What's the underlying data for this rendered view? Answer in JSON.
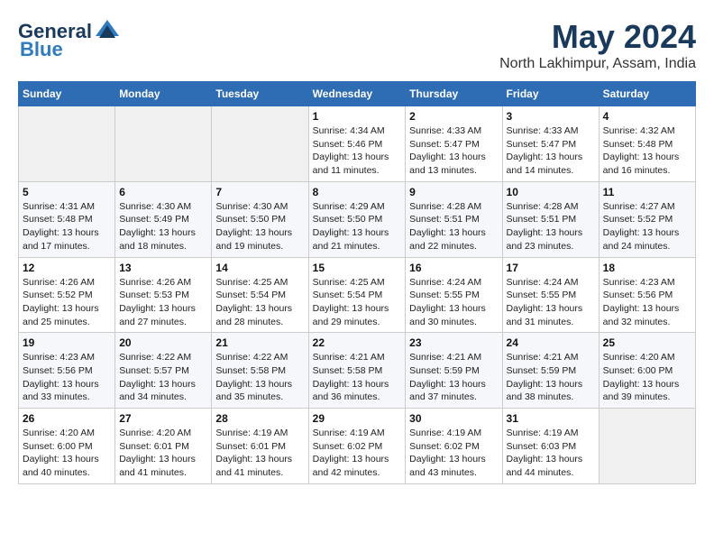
{
  "logo": {
    "general": "General",
    "blue": "Blue"
  },
  "title": "May 2024",
  "location": "North Lakhimpur, Assam, India",
  "weekdays": [
    "Sunday",
    "Monday",
    "Tuesday",
    "Wednesday",
    "Thursday",
    "Friday",
    "Saturday"
  ],
  "weeks": [
    [
      {
        "day": "",
        "info": ""
      },
      {
        "day": "",
        "info": ""
      },
      {
        "day": "",
        "info": ""
      },
      {
        "day": "1",
        "info": "Sunrise: 4:34 AM\nSunset: 5:46 PM\nDaylight: 13 hours\nand 11 minutes."
      },
      {
        "day": "2",
        "info": "Sunrise: 4:33 AM\nSunset: 5:47 PM\nDaylight: 13 hours\nand 13 minutes."
      },
      {
        "day": "3",
        "info": "Sunrise: 4:33 AM\nSunset: 5:47 PM\nDaylight: 13 hours\nand 14 minutes."
      },
      {
        "day": "4",
        "info": "Sunrise: 4:32 AM\nSunset: 5:48 PM\nDaylight: 13 hours\nand 16 minutes."
      }
    ],
    [
      {
        "day": "5",
        "info": "Sunrise: 4:31 AM\nSunset: 5:48 PM\nDaylight: 13 hours\nand 17 minutes."
      },
      {
        "day": "6",
        "info": "Sunrise: 4:30 AM\nSunset: 5:49 PM\nDaylight: 13 hours\nand 18 minutes."
      },
      {
        "day": "7",
        "info": "Sunrise: 4:30 AM\nSunset: 5:50 PM\nDaylight: 13 hours\nand 19 minutes."
      },
      {
        "day": "8",
        "info": "Sunrise: 4:29 AM\nSunset: 5:50 PM\nDaylight: 13 hours\nand 21 minutes."
      },
      {
        "day": "9",
        "info": "Sunrise: 4:28 AM\nSunset: 5:51 PM\nDaylight: 13 hours\nand 22 minutes."
      },
      {
        "day": "10",
        "info": "Sunrise: 4:28 AM\nSunset: 5:51 PM\nDaylight: 13 hours\nand 23 minutes."
      },
      {
        "day": "11",
        "info": "Sunrise: 4:27 AM\nSunset: 5:52 PM\nDaylight: 13 hours\nand 24 minutes."
      }
    ],
    [
      {
        "day": "12",
        "info": "Sunrise: 4:26 AM\nSunset: 5:52 PM\nDaylight: 13 hours\nand 25 minutes."
      },
      {
        "day": "13",
        "info": "Sunrise: 4:26 AM\nSunset: 5:53 PM\nDaylight: 13 hours\nand 27 minutes."
      },
      {
        "day": "14",
        "info": "Sunrise: 4:25 AM\nSunset: 5:54 PM\nDaylight: 13 hours\nand 28 minutes."
      },
      {
        "day": "15",
        "info": "Sunrise: 4:25 AM\nSunset: 5:54 PM\nDaylight: 13 hours\nand 29 minutes."
      },
      {
        "day": "16",
        "info": "Sunrise: 4:24 AM\nSunset: 5:55 PM\nDaylight: 13 hours\nand 30 minutes."
      },
      {
        "day": "17",
        "info": "Sunrise: 4:24 AM\nSunset: 5:55 PM\nDaylight: 13 hours\nand 31 minutes."
      },
      {
        "day": "18",
        "info": "Sunrise: 4:23 AM\nSunset: 5:56 PM\nDaylight: 13 hours\nand 32 minutes."
      }
    ],
    [
      {
        "day": "19",
        "info": "Sunrise: 4:23 AM\nSunset: 5:56 PM\nDaylight: 13 hours\nand 33 minutes."
      },
      {
        "day": "20",
        "info": "Sunrise: 4:22 AM\nSunset: 5:57 PM\nDaylight: 13 hours\nand 34 minutes."
      },
      {
        "day": "21",
        "info": "Sunrise: 4:22 AM\nSunset: 5:58 PM\nDaylight: 13 hours\nand 35 minutes."
      },
      {
        "day": "22",
        "info": "Sunrise: 4:21 AM\nSunset: 5:58 PM\nDaylight: 13 hours\nand 36 minutes."
      },
      {
        "day": "23",
        "info": "Sunrise: 4:21 AM\nSunset: 5:59 PM\nDaylight: 13 hours\nand 37 minutes."
      },
      {
        "day": "24",
        "info": "Sunrise: 4:21 AM\nSunset: 5:59 PM\nDaylight: 13 hours\nand 38 minutes."
      },
      {
        "day": "25",
        "info": "Sunrise: 4:20 AM\nSunset: 6:00 PM\nDaylight: 13 hours\nand 39 minutes."
      }
    ],
    [
      {
        "day": "26",
        "info": "Sunrise: 4:20 AM\nSunset: 6:00 PM\nDaylight: 13 hours\nand 40 minutes."
      },
      {
        "day": "27",
        "info": "Sunrise: 4:20 AM\nSunset: 6:01 PM\nDaylight: 13 hours\nand 41 minutes."
      },
      {
        "day": "28",
        "info": "Sunrise: 4:19 AM\nSunset: 6:01 PM\nDaylight: 13 hours\nand 41 minutes."
      },
      {
        "day": "29",
        "info": "Sunrise: 4:19 AM\nSunset: 6:02 PM\nDaylight: 13 hours\nand 42 minutes."
      },
      {
        "day": "30",
        "info": "Sunrise: 4:19 AM\nSunset: 6:02 PM\nDaylight: 13 hours\nand 43 minutes."
      },
      {
        "day": "31",
        "info": "Sunrise: 4:19 AM\nSunset: 6:03 PM\nDaylight: 13 hours\nand 44 minutes."
      },
      {
        "day": "",
        "info": ""
      }
    ]
  ]
}
